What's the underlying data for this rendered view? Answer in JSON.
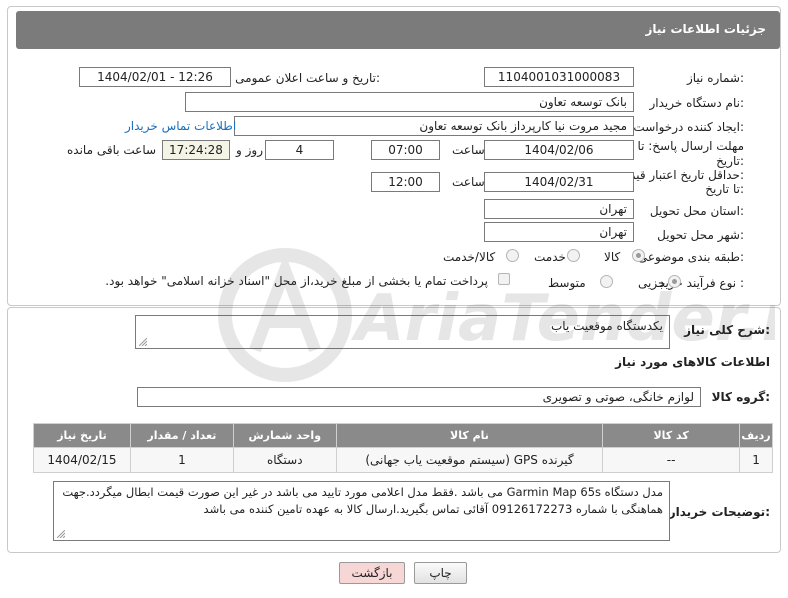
{
  "header": {
    "title": "جزئیات اطلاعات نیاز"
  },
  "form": {
    "need_number_label": "شماره نیاز:",
    "need_number": "1104001031000083",
    "announce_label": "تاریخ و ساعت اعلان عمومی:",
    "announce_value": "1404/02/01 - 12:26",
    "buyer_org_label": "نام دستگاه خریدار:",
    "buyer_org": "بانک توسعه تعاون",
    "creator_label": "ایجاد کننده درخواست:",
    "creator": "مجید مروت نیا کارپرداز بانک توسعه تعاون",
    "contact_link": "اطلاعات تماس خریدار",
    "reply_deadline_label_1": "مهلت ارسال پاسخ: تا",
    "reply_deadline_label_2": "تاریخ:",
    "reply_date": "1404/02/06",
    "time_label": "ساعت",
    "reply_time": "07:00",
    "days": "4",
    "days_label": "روز و",
    "remaining_time": "17:24:28",
    "remaining_label": "ساعت باقی مانده",
    "min_price_label_1": "حداقل تاریخ اعتبار قیمت:",
    "min_price_label_2": "تا تاریخ:",
    "price_date": "1404/02/31",
    "price_time": "12:00",
    "province_label": "استان محل تحویل:",
    "province": "تهران",
    "city_label": "شهر محل تحویل:",
    "city": "تهران",
    "category_label": "طبقه بندی موضوعی:",
    "category_options": [
      "کالا",
      "خدمت",
      "کالا/خدمت"
    ],
    "category_selected": "کالا",
    "process_label": "نوع فرآیند خرید :",
    "process_options": [
      "جزیی",
      "متوسط"
    ],
    "process_selected": "جزیی",
    "payment_note": "پرداخت تمام یا بخشی از مبلغ خرید،از محل \"اسناد خزانه اسلامی\" خواهد بود."
  },
  "details": {
    "summary_label": "شرح کلی نیاز:",
    "summary": "یکدستگاه موقعیت یاب",
    "items_title": "اطلاعات کالاهای مورد نیاز",
    "group_label": "گروه کالا:",
    "group": "لوازم خانگی، صوتی و تصویری",
    "table_headers": [
      "ردیف",
      "کد کالا",
      "نام کالا",
      "واحد شمارش",
      "تعداد / مقدار",
      "تاریخ نیاز"
    ],
    "rows": [
      [
        "1",
        "--",
        "گیرنده GPS (سیستم موقعیت یاب جهانی)",
        "دستگاه",
        "1",
        "1404/02/15"
      ]
    ],
    "buyer_notes_label": "توضیحات خریدار:",
    "buyer_notes": "مدل دستگاه Garmin Map 65s می باشد .فقط مدل اعلامی مورد تایید می باشد در غیر این صورت قیمت ابطال میگردد.جهت هماهنگی با شماره 09126172273 آقائی تماس بگیرید.ارسال کالا به عهده تامین کننده می باشد"
  },
  "buttons": {
    "print": "چاپ",
    "back": "بازگشت"
  },
  "watermark": {
    "text": "AriaTender.neT"
  },
  "colors": {
    "header_bg": "#7b7b7b",
    "table_header_bg": "#8a8a8a",
    "link": "#1a6fbf",
    "back_button_bg": "#f7d6d6"
  }
}
